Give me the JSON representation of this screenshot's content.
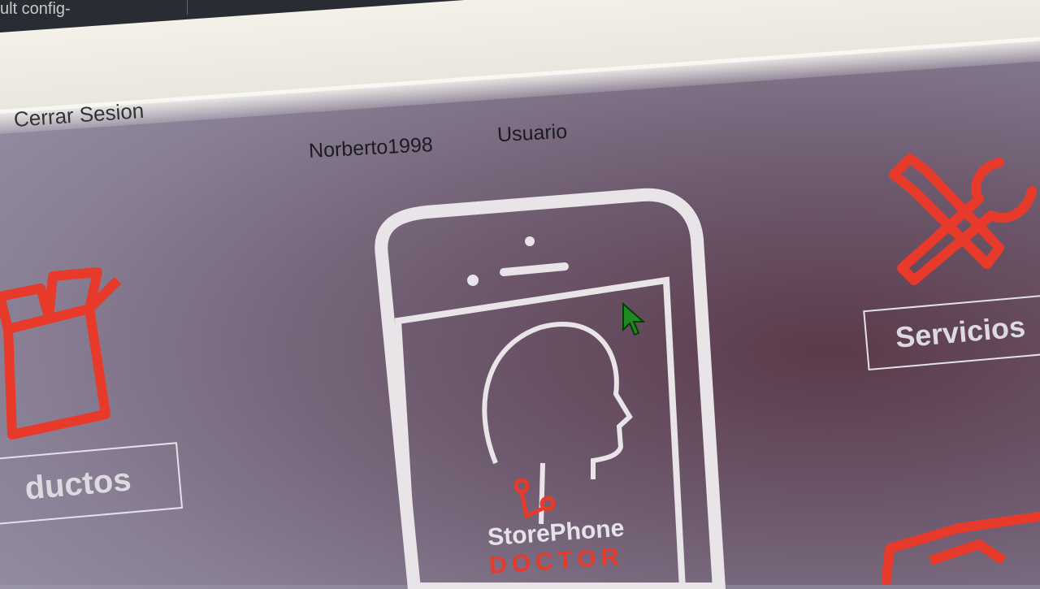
{
  "window": {
    "tab_text": "ult config-"
  },
  "header": {
    "logout_label": "Cerrar Sesion",
    "username": "Norberto1998",
    "user_label": "Usuario"
  },
  "cards": {
    "productos_label": "ductos",
    "servicios_label": "Servicios"
  },
  "logo": {
    "brand_top": "StorePhone",
    "brand_bottom": "DOCTOR"
  },
  "colors": {
    "accent": "#e83a2a",
    "outline": "#e8e4e8",
    "cursor": "#1f8a1f"
  },
  "icons": {
    "products": "open-box-icon",
    "services": "tools-icon",
    "phone": "phone-head-icon"
  }
}
